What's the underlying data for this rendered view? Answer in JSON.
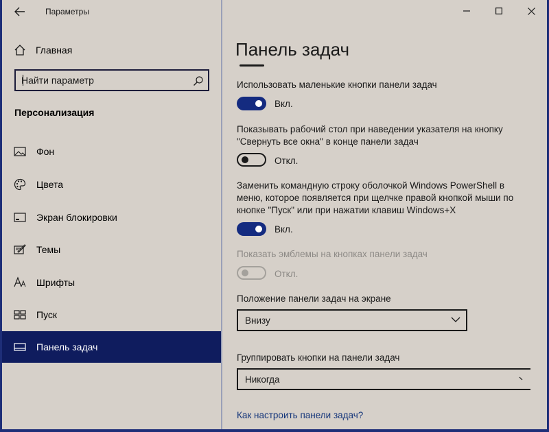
{
  "app": {
    "title": "Параметры"
  },
  "sidebar": {
    "home_label": "Главная",
    "search_placeholder": "Найти параметр",
    "section_title": "Персонализация",
    "items": [
      {
        "label": "Фон",
        "icon": "picture-icon"
      },
      {
        "label": "Цвета",
        "icon": "palette-icon"
      },
      {
        "label": "Экран блокировки",
        "icon": "lock-screen-icon"
      },
      {
        "label": "Темы",
        "icon": "themes-icon"
      },
      {
        "label": "Шрифты",
        "icon": "fonts-icon"
      },
      {
        "label": "Пуск",
        "icon": "start-icon"
      },
      {
        "label": "Панель задач",
        "icon": "taskbar-icon",
        "active": true
      }
    ]
  },
  "main": {
    "title": "Панель задач",
    "settings": [
      {
        "label": "Использовать маленькие кнопки панели задач",
        "state": "on",
        "state_label": "Вкл."
      },
      {
        "label": "Показывать рабочий стол при наведении указателя на кнопку \"Свернуть все окна\" в конце панели задач",
        "state": "off",
        "state_label": "Откл."
      },
      {
        "label": "Заменить командную строку оболочкой Windows PowerShell в меню, которое появляется при щелчке правой кнопкой мыши по кнопке \"Пуск\" или при нажатии клавиш Windows+X",
        "state": "on",
        "state_label": "Вкл."
      },
      {
        "label": "Показать эмблемы на кнопках панели задач",
        "state": "disabled",
        "state_label": "Откл."
      }
    ],
    "position": {
      "label": "Положение панели задач на экране",
      "value": "Внизу"
    },
    "grouping": {
      "label": "Группировать кнопки на панели задач",
      "value": "Никогда"
    },
    "help_link": "Как настроить панели задач?"
  },
  "colors": {
    "accent": "#0f1c5e",
    "toggle_on": "#142b80",
    "background": "#d6d0c9",
    "link": "#14357a"
  }
}
